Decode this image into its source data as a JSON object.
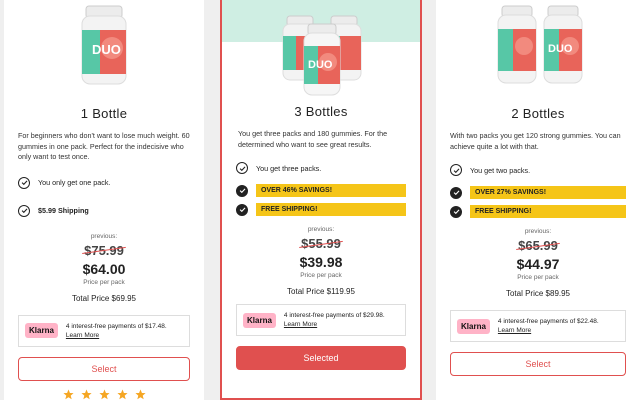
{
  "colors": {
    "accent": "#e0504f",
    "highlight": "#f5c518",
    "hero_bg": "#cfeee3",
    "klarna_pink": "#ffb3c7"
  },
  "cards": [
    {
      "product_label": "DUO",
      "title": "1 Bottle",
      "description": "For beginners who don't want to lose much weight. 60 gummies in one pack. Perfect for the indecisive who only want to test once.",
      "features": [
        "You only get one pack.",
        "$5.99 Shipping"
      ],
      "previous_label": "previous:",
      "old_price": "$75.99",
      "price": "$64.00",
      "price_per": "Price per pack",
      "total": "Total Price $69.95",
      "klarna": {
        "logo": "Klarna",
        "text": "4 interest-free payments of $17.48.",
        "learn": "Learn More"
      },
      "button": "Select",
      "rating": 5
    },
    {
      "product_label": "DUO",
      "title": "3 Bottles",
      "description": "You get three packs and 180 gummies. For the determined who want to see great results.",
      "features": [
        "You get three packs.",
        "OVER 46% SAVINGS!",
        "FREE SHIPPING!"
      ],
      "previous_label": "previous:",
      "old_price": "$55.99",
      "price": "$39.98",
      "price_per": "Price per pack",
      "total": "Total Price $119.95",
      "klarna": {
        "logo": "Klarna",
        "text": "4 interest-free payments of $29.98.",
        "learn": "Learn More"
      },
      "button": "Selected"
    },
    {
      "product_label": "DUO",
      "title": "2 Bottles",
      "description": "With two packs you get 120 strong gummies. You can achieve quite a lot with that.",
      "features": [
        "You get two packs.",
        "OVER 27% SAVINGS!",
        "FREE SHIPPING!"
      ],
      "previous_label": "previous:",
      "old_price": "$65.99",
      "price": "$44.97",
      "price_per": "Price per pack",
      "total": "Total Price $89.95",
      "klarna": {
        "logo": "Klarna",
        "text": "4 interest-free payments of $22.48.",
        "learn": "Learn More"
      },
      "button": "Select"
    }
  ]
}
